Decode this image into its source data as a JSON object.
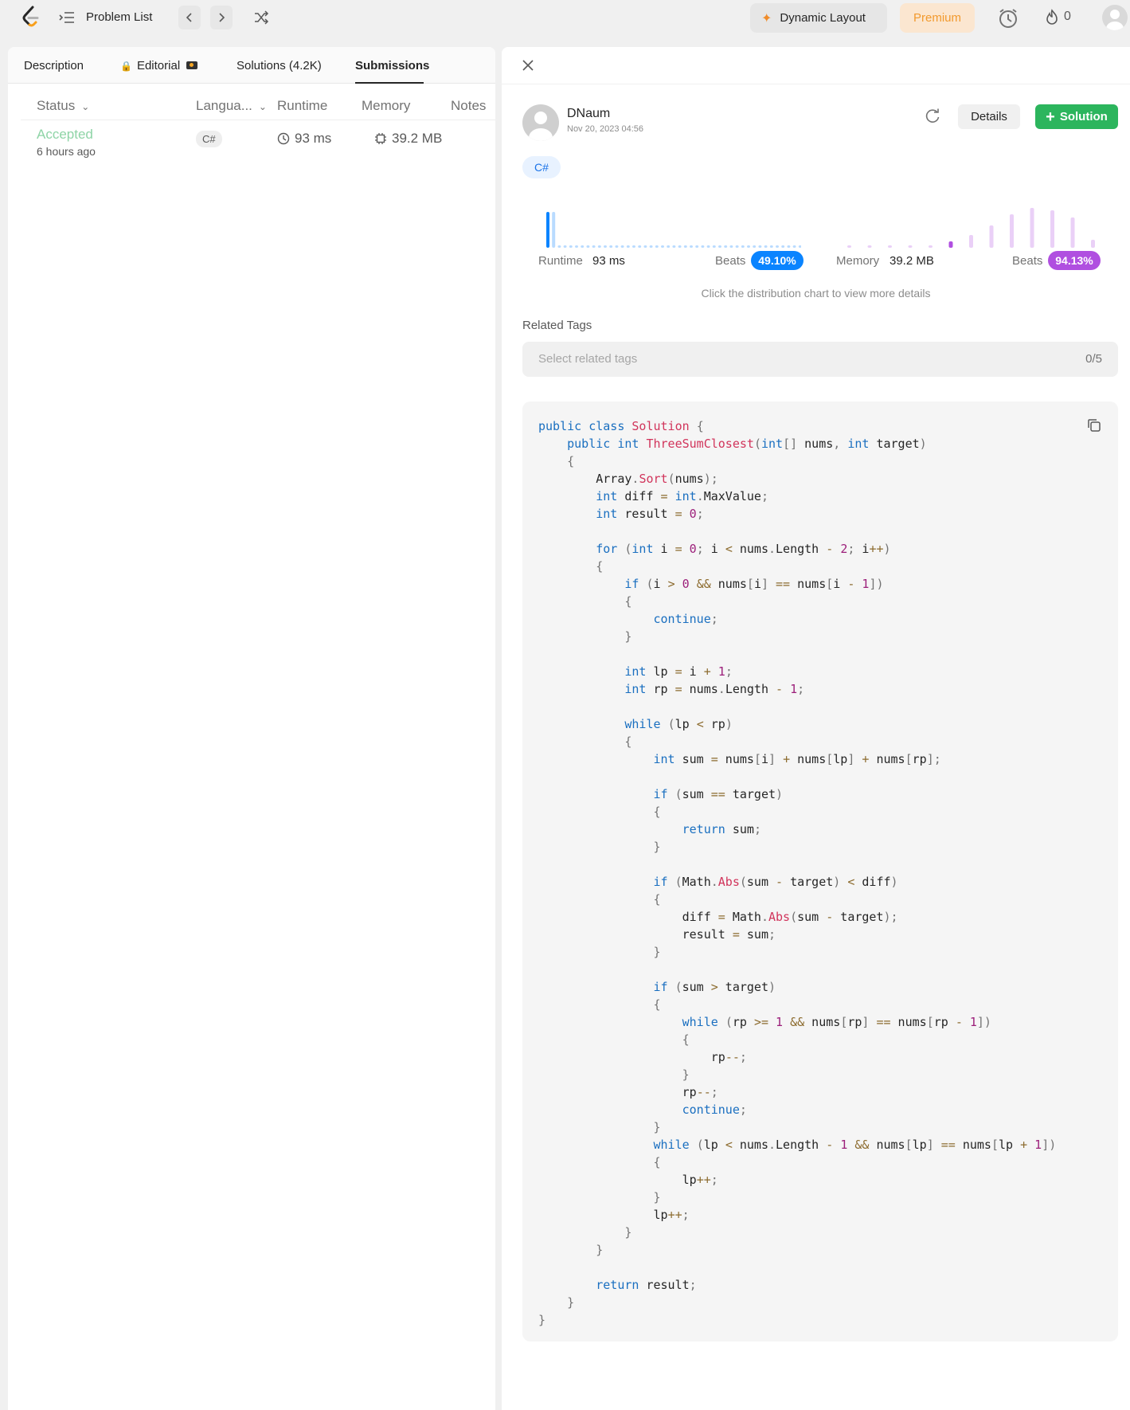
{
  "nav": {
    "title": "Problem List",
    "dynamic_layout": "Dynamic Layout",
    "premium": "Premium",
    "streak": "0"
  },
  "tabs": {
    "description": "Description",
    "editorial": "Editorial",
    "solutions": "Solutions (4.2K)",
    "submissions": "Submissions"
  },
  "table": {
    "headers": {
      "status": "Status",
      "language": "Langua...",
      "runtime": "Runtime",
      "memory": "Memory",
      "notes": "Notes"
    },
    "rows": [
      {
        "status": "Accepted",
        "time_ago": "6 hours ago",
        "language": "C#",
        "runtime": "93 ms",
        "memory": "39.2 MB"
      }
    ]
  },
  "submission": {
    "username": "DNaum",
    "date": "Nov 20, 2023 04:56",
    "details_label": "Details",
    "solution_label": "Solution",
    "language": "C#",
    "runtime_label": "Runtime",
    "runtime_value": "93 ms",
    "runtime_beats_label": "Beats",
    "runtime_beats": "49.10%",
    "memory_label": "Memory",
    "memory_value": "39.2 MB",
    "memory_beats_label": "Beats",
    "memory_beats": "94.13%",
    "hint": "Click the distribution chart to view more details",
    "related_tags_label": "Related Tags",
    "tags_placeholder": "Select related tags",
    "tags_count": "0/5"
  },
  "colors": {
    "runtime_accent": "#0a84ff",
    "memory_accent": "#b04fe0",
    "accepted": "#8ed4a6",
    "solution_button": "#2cb55d"
  },
  "chart_data": [
    {
      "type": "bar",
      "name": "runtime-distribution",
      "highlight_index": 0,
      "values": [
        0.45,
        0.45,
        0.02,
        0.02,
        0.02,
        0.02,
        0.02,
        0.02,
        0.02,
        0.02,
        0.02,
        0.02,
        0.02,
        0.02,
        0.02,
        0.02,
        0.02,
        0.02,
        0.02,
        0.02,
        0.02,
        0.02,
        0.02,
        0.02,
        0.02,
        0.02,
        0.02,
        0.02,
        0.02,
        0.02,
        0.02,
        0.02,
        0.02,
        0.02,
        0.02,
        0.02,
        0.02,
        0.02,
        0.02,
        0.02,
        0.02,
        0.02,
        0.02,
        0.02,
        0.02
      ]
    },
    {
      "type": "bar",
      "name": "memory-distribution",
      "highlight_index": 5,
      "values": [
        0.02,
        0.02,
        0.02,
        0.02,
        0.02,
        0.08,
        0.16,
        0.28,
        0.42,
        0.5,
        0.47,
        0.38,
        0.1
      ]
    }
  ]
}
